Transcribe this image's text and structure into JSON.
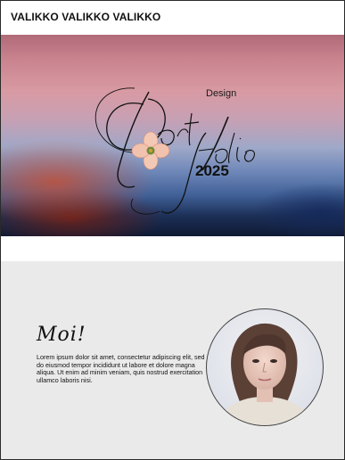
{
  "nav": {
    "title": "VALIKKO VALIKKO VALIKKO"
  },
  "hero": {
    "design_label": "Design",
    "portfolio_script": "Portfolio",
    "year": "2025"
  },
  "about": {
    "greeting": "Moi!",
    "body": "Lorem ipsum dolor sit amet, consectetur adipiscing elit, sed do eiusmod tempor incididunt ut labore et dolore magna aliqua. Ut enim ad minim veniam, quis nostrud exercitation ullamco laboris nisi."
  },
  "icons": {
    "flower": "flower-icon",
    "portrait": "profile-photo"
  },
  "colors": {
    "hero_top": "#c9838f",
    "hero_bottom": "#1c2f56",
    "about_bg": "#eaeaea"
  }
}
